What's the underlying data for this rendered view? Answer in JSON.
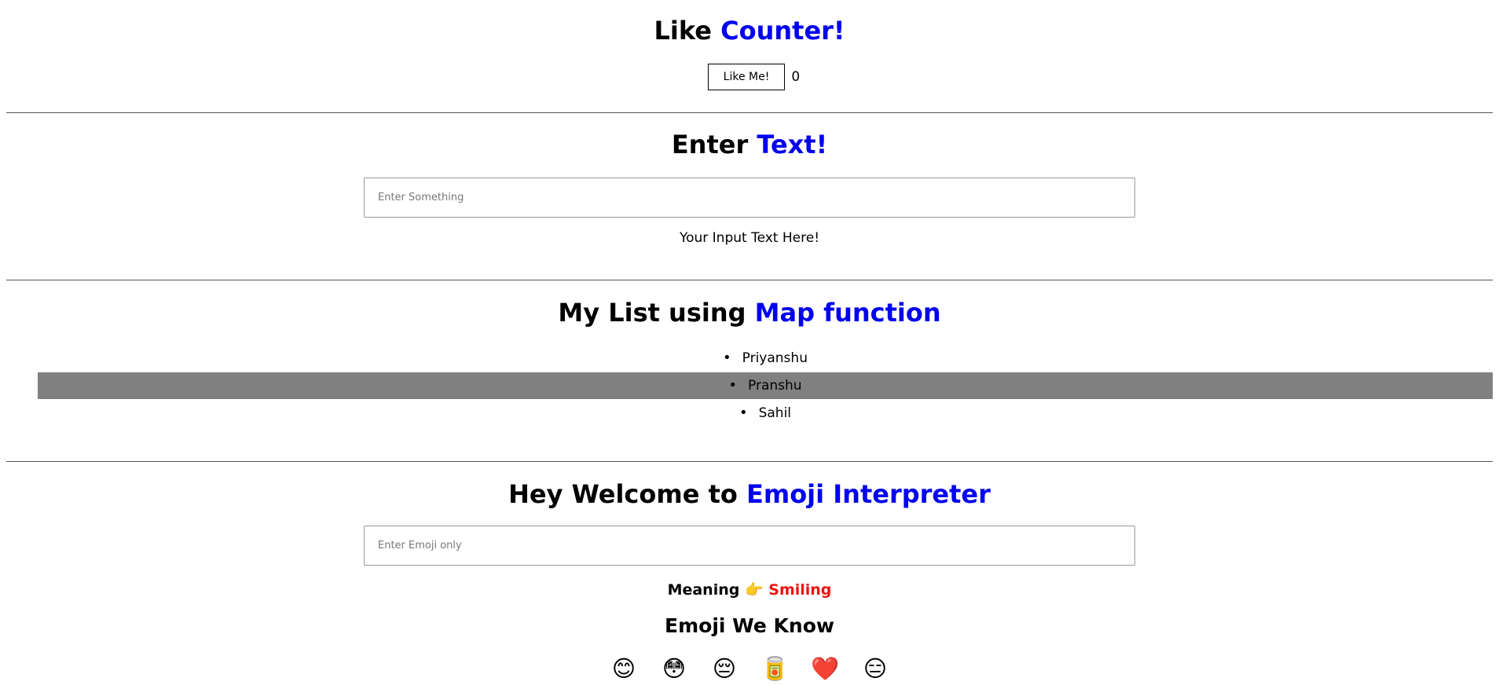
{
  "like": {
    "title_plain": "Like ",
    "title_accent": "Counter!",
    "button_label": "Like Me!",
    "count": "0"
  },
  "text": {
    "title_plain": "Enter ",
    "title_accent": "Text!",
    "input_placeholder": "Enter Something",
    "output": "Your Input Text Here!"
  },
  "list": {
    "title_plain": "My List using ",
    "title_accent": "Map function",
    "items": [
      {
        "label": "Priyanshu"
      },
      {
        "label": "Pranshu"
      },
      {
        "label": "Sahil"
      }
    ]
  },
  "emoji": {
    "title_plain": "Hey Welcome to ",
    "title_accent": "Emoji Interpreter",
    "input_placeholder": "Enter Emoji only",
    "meaning_label": "Meaning",
    "meaning_pointer": "👉",
    "meaning_value": "Smiling",
    "known_title": "Emoji We Know",
    "known": [
      "😊",
      "😳",
      "😔",
      "🥫",
      "❤️",
      "😑"
    ]
  },
  "colors": {
    "accent": "#0000ee",
    "meaning": "#ee1111",
    "highlight": "#808080"
  }
}
